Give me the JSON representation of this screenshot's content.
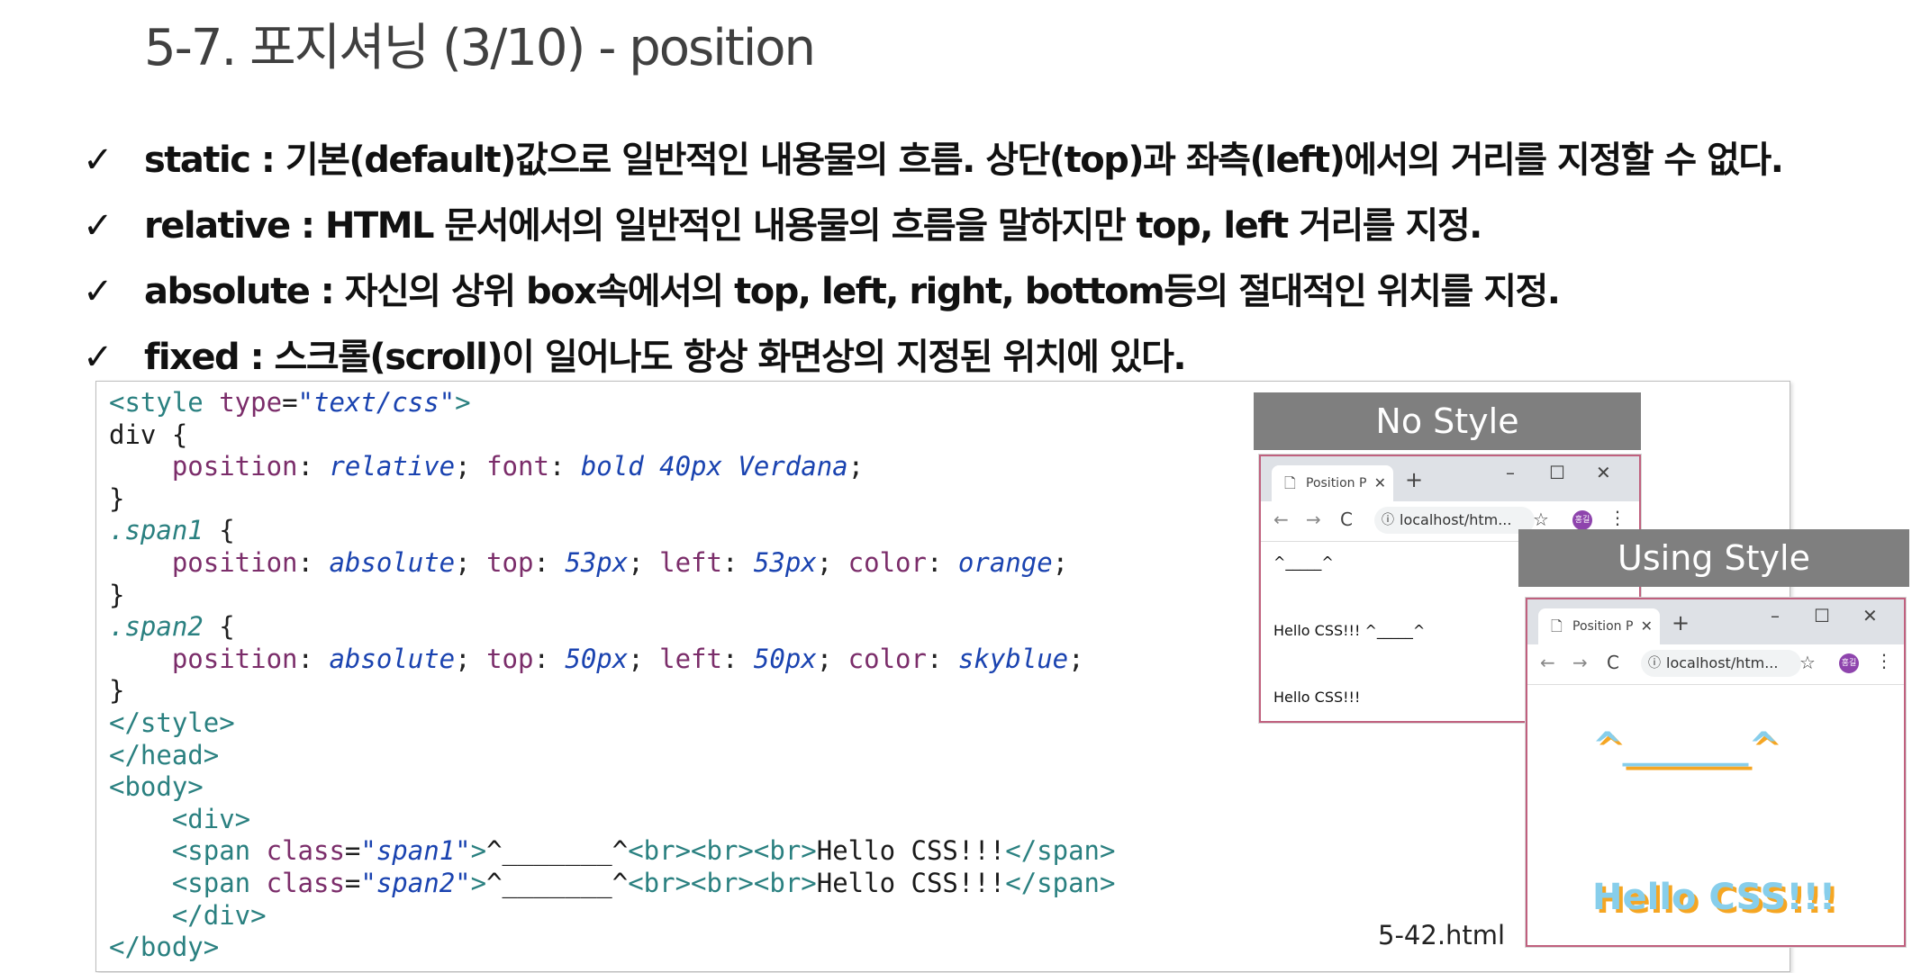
{
  "title": "5-7. 포지셔닝 (3/10) - position",
  "bullets": [
    {
      "check": "✓",
      "text": "static : 기본(default)값으로 일반적인 내용물의 흐름. 상단(top)과 좌측(left)에서의 거리를 지정할 수 없다."
    },
    {
      "check": "✓",
      "text": "relative : HTML 문서에서의 일반적인 내용물의 흐름을 말하지만 top, left 거리를 지정."
    },
    {
      "check": "✓",
      "text": "absolute : 자신의 상위 box속에서의 top, left, right, bottom등의 절대적인 위치를 지정."
    },
    {
      "check": "✓",
      "text": "fixed : 스크롤(scroll)이 일어나도 항상 화면상의 지정된 위치에 있다."
    }
  ],
  "code": {
    "l1": {
      "a": "<style ",
      "b": "type",
      "c": "=",
      "d": "\"text/css\"",
      "e": ">"
    },
    "l2": "div {",
    "l3": {
      "ind": "    ",
      "p1": "position",
      "s1": ": ",
      "v1": "relative",
      "s2": "; ",
      "p2": "font",
      "s3": ": ",
      "v2": "bold 40px Verdana",
      "s4": ";"
    },
    "l4": "}",
    "l5": {
      "c": ".span1",
      "r": " {"
    },
    "l6": {
      "ind": "    ",
      "p1": "position",
      "s1": ": ",
      "v1": "absolute",
      "s2": "; ",
      "p2": "top",
      "s3": ": ",
      "v2": "53px",
      "s4": "; ",
      "p3": "left",
      "s5": ": ",
      "v3": "53px",
      "s6": "; ",
      "p4": "color",
      "s7": ": ",
      "v4": "orange",
      "s8": ";"
    },
    "l7": "}",
    "l8": {
      "c": ".span2",
      "r": " {"
    },
    "l9": {
      "ind": "    ",
      "p1": "position",
      "s1": ": ",
      "v1": "absolute",
      "s2": "; ",
      "p2": "top",
      "s3": ": ",
      "v2": "50px",
      "s4": "; ",
      "p3": "left",
      "s5": ": ",
      "v3": "50px",
      "s6": "; ",
      "p4": "color",
      "s7": ": ",
      "v4": "skyblue",
      "s8": ";"
    },
    "l10": "}",
    "l11": "</style>",
    "l12": "</head>",
    "l13": "<body>",
    "l14": "    <div>",
    "l15": {
      "ind": "    ",
      "a": "<span ",
      "b": "class",
      "c": "=",
      "d": "\"span1\"",
      "e": ">",
      "f": "^_______^",
      "g": "<br><br><br>",
      "h": "Hello CSS!!!",
      "i": "</span>"
    },
    "l16": {
      "ind": "    ",
      "a": "<span ",
      "b": "class",
      "c": "=",
      "d": "\"span2\"",
      "e": ">",
      "f": "^_______^",
      "g": "<br><br><br>",
      "h": "Hello CSS!!!",
      "i": "</span>"
    },
    "l17": "    </div>",
    "l18": "</body>"
  },
  "file_label": "5-42.html",
  "nostyle": {
    "header": "No Style",
    "tab_title": "Position P",
    "url": "localhost/htm...",
    "avatar": "홍길",
    "line1": "^_____^",
    "line2": "Hello CSS!!! ^_____^",
    "line3": "Hello CSS!!!"
  },
  "usingstyle": {
    "header": "Using Style",
    "tab_title": "Position P",
    "url": "localhost/htm...",
    "avatar": "홍길",
    "face": "^_______^",
    "hello": "Hello CSS!!!",
    "color1": "#f5a623",
    "color2": "#87ceeb"
  },
  "icons": {
    "doc": "🗋",
    "close": "✕",
    "plus": "+",
    "min": "–",
    "max": "☐",
    "back": "←",
    "fwd": "→",
    "reload": "C",
    "info": "ⓘ",
    "star": "☆",
    "kebab": "⋮"
  }
}
